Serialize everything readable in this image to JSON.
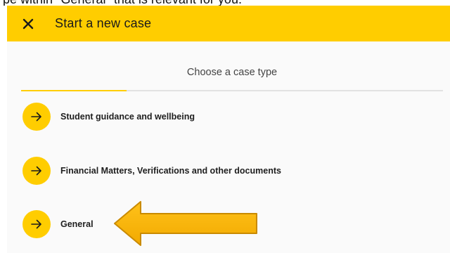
{
  "caption": "pe within \"General\" that is relevant for you.",
  "header": {
    "title": "Start a new case",
    "close_icon": "close-icon"
  },
  "tabs": {
    "active_label": "Choose a case type",
    "progress_fraction": 0.25
  },
  "case_types": [
    {
      "label": "Student guidance and wellbeing",
      "icon": "arrow-right-icon"
    },
    {
      "label": "Financial Matters, Verifications and other documents",
      "icon": "arrow-right-icon"
    },
    {
      "label": "General",
      "icon": "arrow-right-icon"
    }
  ],
  "colors": {
    "accent": "#ffcd00",
    "annotation_fill": "#f5b301",
    "annotation_stroke": "#c98a00"
  }
}
